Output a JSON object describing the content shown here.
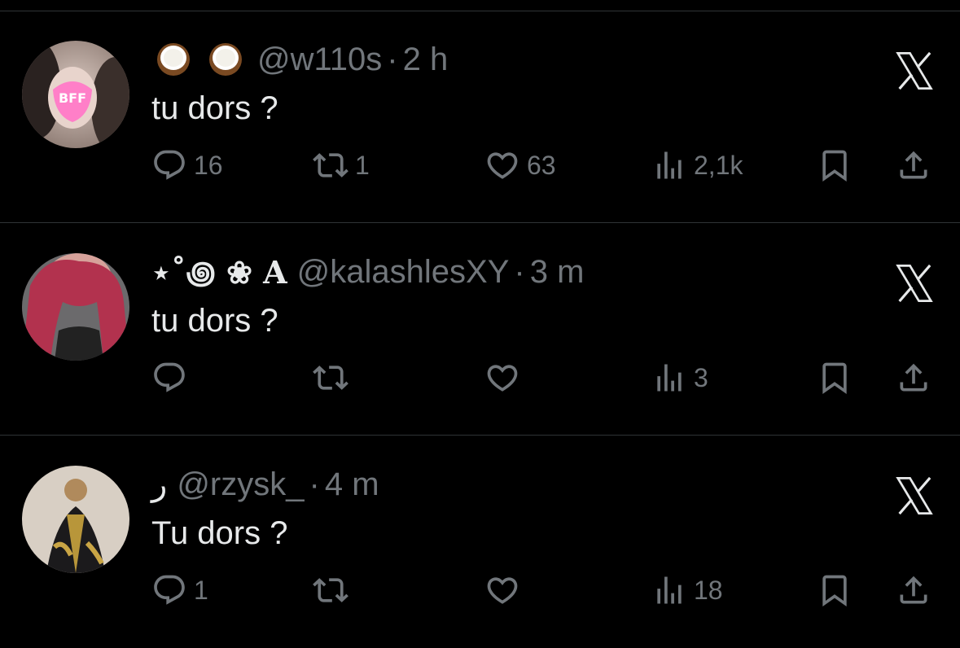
{
  "tweets": [
    {
      "display_name_icons": [
        "coconut-icon",
        "coconut-icon"
      ],
      "display_name": "",
      "handle": "@w110s",
      "separator": "·",
      "time": "2 h",
      "text": "tu dors ?",
      "replies": "16",
      "retweets": "1",
      "likes": "63",
      "views": "2,1k"
    },
    {
      "display_name": "⋆˚꩜ ❀ 𝐀",
      "handle": "@kalashlesXY",
      "separator": "·",
      "time": "3 m",
      "text": "tu dors ?",
      "replies": "",
      "retweets": "",
      "likes": "",
      "views": "3"
    },
    {
      "display_name": "ر",
      "handle": "@rzysk_",
      "separator": "·",
      "time": "4 m",
      "text": "Tu dors ?",
      "replies": "1",
      "retweets": "",
      "likes": "",
      "views": "18"
    }
  ],
  "colors": {
    "background": "#000000",
    "text_primary": "#e7e9ea",
    "text_secondary": "#71767b",
    "divider": "#2f3336"
  }
}
